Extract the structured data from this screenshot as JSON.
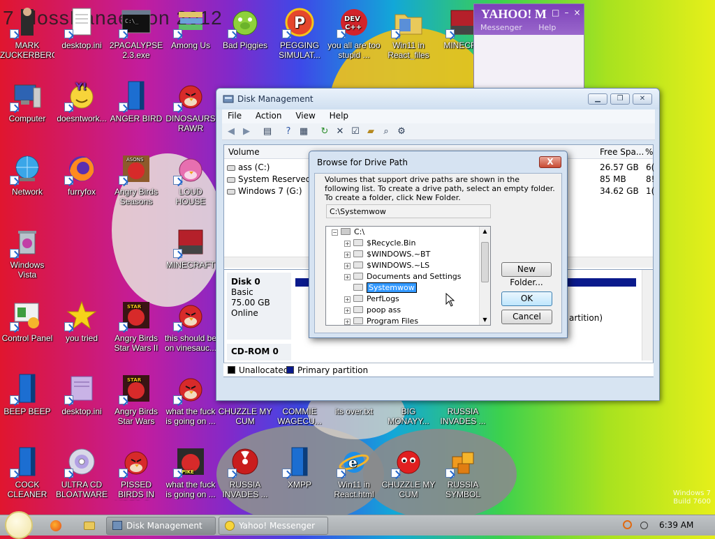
{
  "desktop": {
    "overlay_text": "7 blossKanae tion 2012",
    "icons": [
      {
        "label": "MARK ZUCKERBERG",
        "icon": "person-figure"
      },
      {
        "label": "desktop.ini",
        "icon": "text-file"
      },
      {
        "label": "2PACALYPSE 2.3.exe",
        "icon": "console-window"
      },
      {
        "label": "Among Us",
        "icon": "stacked-books"
      },
      {
        "label": "Bad Piggies",
        "icon": "green-pig"
      },
      {
        "label": "PEGGING SIMULAT...",
        "icon": "red-circle-p"
      },
      {
        "label": "you all are too stupid ...",
        "icon": "dev-cpp"
      },
      {
        "label": "Win11 in React_files",
        "icon": "folder"
      },
      {
        "label": "MINECRA",
        "icon": "red-block"
      },
      {
        "label": "Computer",
        "icon": "computer"
      },
      {
        "label": "doesntwork...",
        "icon": "yahoo-smiley"
      },
      {
        "label": "ANGER BIRD",
        "icon": "blue-book"
      },
      {
        "label": "DINOSAURS RAWR",
        "icon": "angry-bird"
      },
      {
        "label": "Network",
        "icon": "globe"
      },
      {
        "label": "furryfox",
        "icon": "firefox"
      },
      {
        "label": "Angry Birds Seasons",
        "icon": "angry-birds-seasons"
      },
      {
        "label": "LOUD HOUSE",
        "icon": "angry-bird-pink"
      },
      {
        "label": "Windows Vista",
        "icon": "recycle-bin"
      },
      {
        "label": "MINECRAFT",
        "icon": "red-block"
      },
      {
        "label": "Control Panel",
        "icon": "control-panel"
      },
      {
        "label": "you tried",
        "icon": "gold-star"
      },
      {
        "label": "Angry Birds Star Wars II",
        "icon": "star-wars-bird"
      },
      {
        "label": "this should be on vinesauc...",
        "icon": "angry-bird"
      },
      {
        "label": "BEEP BEEP",
        "icon": "blue-book"
      },
      {
        "label": "desktop.ini",
        "icon": "text-file-purple"
      },
      {
        "label": "Angry Birds Star Wars",
        "icon": "star-wars-bird"
      },
      {
        "label": "what the fuck is going on ...",
        "icon": "angry-bird"
      },
      {
        "label": "CHUZZLE MY CUM",
        "icon": "blank"
      },
      {
        "label": "COMMIE WAGECU...",
        "icon": "blank"
      },
      {
        "label": "its over.txt",
        "icon": "blank"
      },
      {
        "label": "BIG MONAYY...",
        "icon": "blank"
      },
      {
        "label": "RUSSIA INVADES ...",
        "icon": "blank"
      },
      {
        "label": "COCK CLEANER",
        "icon": "blue-book"
      },
      {
        "label": "ULTRA CD BLOATWARE",
        "icon": "cd-disc"
      },
      {
        "label": "PISSED BIRDS IN VIDEO G...",
        "icon": "angry-bird"
      },
      {
        "label": "what the fuck is going on ...",
        "icon": "angry-bird-dark"
      },
      {
        "label": "RUSSIA INVADES ...",
        "icon": "radiation"
      },
      {
        "label": "XMPP",
        "icon": "blue-book"
      },
      {
        "label": "Win11 in React.html",
        "icon": "internet-explorer"
      },
      {
        "label": "CHUZZLE MY CUM",
        "icon": "red-fuzzball"
      },
      {
        "label": "RUSSIA SYMBOL",
        "icon": "orange-cubes"
      }
    ]
  },
  "yahoo": {
    "title": "YAHOO! M",
    "menu": [
      "Messenger",
      "Help"
    ],
    "controls": [
      "□",
      "–",
      "×"
    ]
  },
  "disk_management": {
    "title": "Disk Management",
    "menu": [
      "File",
      "Action",
      "View",
      "Help"
    ],
    "columns": {
      "volume": "Volume",
      "free_space": "Free Spa...",
      "pct": "%"
    },
    "volumes": [
      {
        "name": "ass (C:)",
        "free": "26.57 GB",
        "pct": "6("
      },
      {
        "name": "System Reserved",
        "free": "85 MB",
        "pct": "8!"
      },
      {
        "name": "Windows 7  (G:)",
        "free": "34.62 GB",
        "pct": "1("
      }
    ],
    "disk0": {
      "name": "Disk 0",
      "type": "Basic",
      "size": "75.00 GB",
      "status": "Online"
    },
    "partition_text": "artition)",
    "cdrom": "CD-ROM 0",
    "legend": {
      "unallocated": "Unallocated",
      "primary": "Primary partition"
    },
    "colors": {
      "unallocated": "#000000",
      "primary": "#0a1a8c"
    }
  },
  "dialog": {
    "title": "Browse for Drive Path",
    "instructions": "Volumes that support drive paths are shown in the following list. To create a drive path, select an empty folder. To create a folder, click New Folder.",
    "path_value": "C:\\Systemwow",
    "tree": {
      "root": "C:\\",
      "items": [
        "$Recycle.Bin",
        "$WINDOWS.~BT",
        "$WINDOWS.~LS",
        "Documents and Settings",
        "Systemwow",
        "PerfLogs",
        "poop ass",
        "Program Files"
      ],
      "editing": "Systemwow"
    },
    "buttons": {
      "new_folder": "New Folder...",
      "ok": "OK",
      "cancel": "Cancel"
    },
    "close": "X"
  },
  "taskbar": {
    "tasks": [
      "Disk Management",
      "Yahoo! Messenger"
    ],
    "clock": "6:39 AM",
    "watermark": [
      "Windows 7",
      "Build 7600"
    ]
  }
}
